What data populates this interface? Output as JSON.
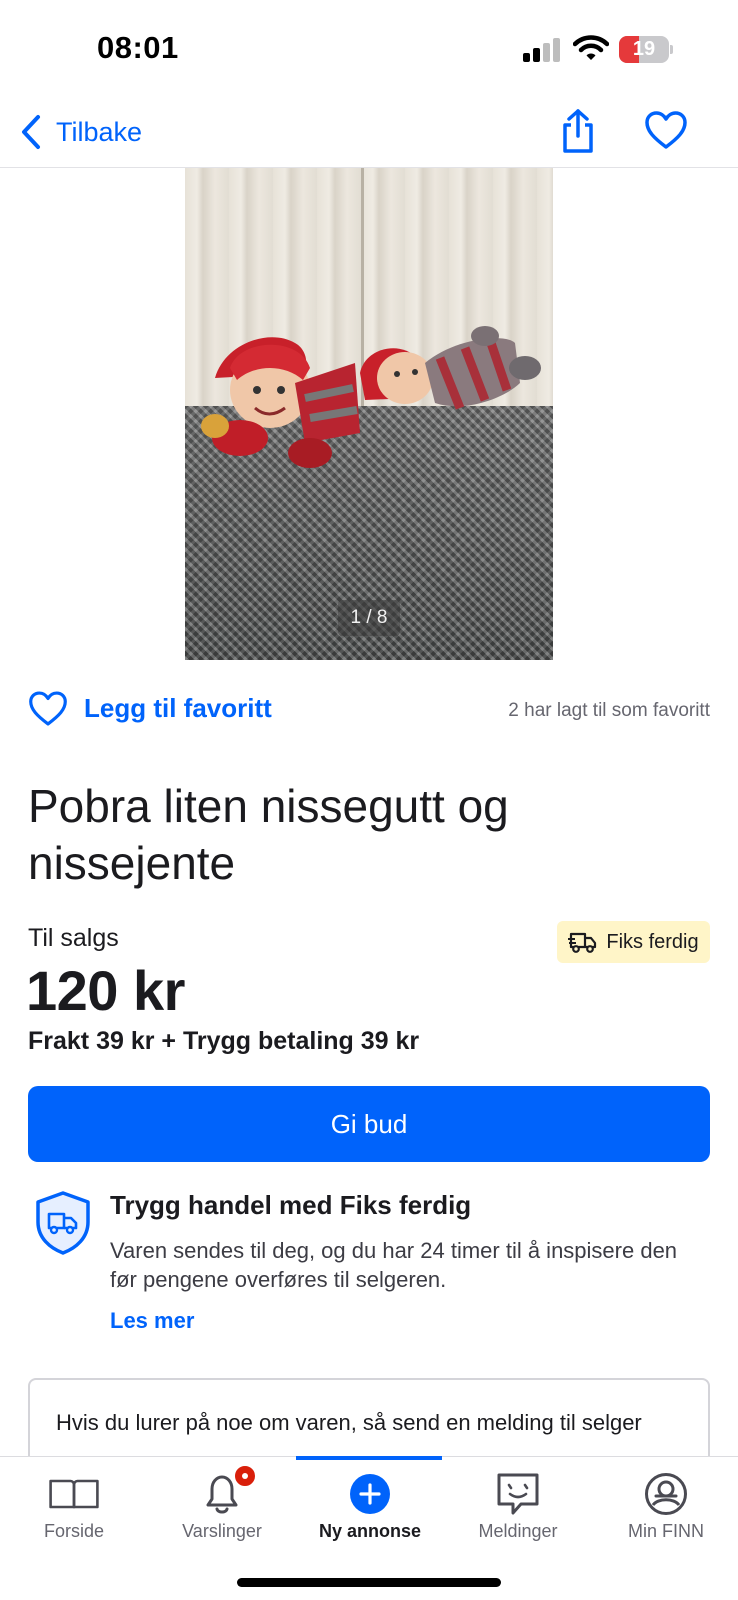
{
  "status_bar": {
    "time": "08:01",
    "battery_level": "19",
    "battery_color": "#e5393b"
  },
  "nav": {
    "back_label": "Tilbake",
    "back_icon": "chevron-left-icon",
    "share_icon": "share-icon",
    "favorite_icon": "heart-outline-icon"
  },
  "gallery": {
    "counter": "1 / 8",
    "current": 1,
    "total": 8
  },
  "favorite": {
    "action_label": "Legg til favoritt",
    "count_text": "2 har lagt til som favoritt"
  },
  "listing": {
    "title": "Pobra liten nissegutt og nissejente",
    "status": "Til salgs",
    "badge": "Fiks ferdig",
    "price": "120 kr",
    "shipping": "Frakt 39 kr + Trygg betaling 39 kr"
  },
  "actions": {
    "bid_label": "Gi bud"
  },
  "safe_trade": {
    "title": "Trygg handel med Fiks ferdig",
    "description": "Varen sendes til deg, og du har 24 timer til å inspisere den før pengene overføres til selgeren.",
    "read_more": "Les mer"
  },
  "message": {
    "prompt": "Hvis du lurer på noe om varen, så send en melding til selger"
  },
  "tabs": [
    {
      "label": "Forside",
      "icon": "book-icon",
      "active": false
    },
    {
      "label": "Varslinger",
      "icon": "bell-icon",
      "active": false,
      "has_badge": true
    },
    {
      "label": "Ny annonse",
      "icon": "plus-circle-icon",
      "active": true
    },
    {
      "label": "Meldinger",
      "icon": "chat-icon",
      "active": false
    },
    {
      "label": "Min FINN",
      "icon": "profile-icon",
      "active": false
    }
  ],
  "colors": {
    "accent": "#0063fb",
    "badge_bg": "#fff5c8",
    "notification": "#d91f0a"
  }
}
